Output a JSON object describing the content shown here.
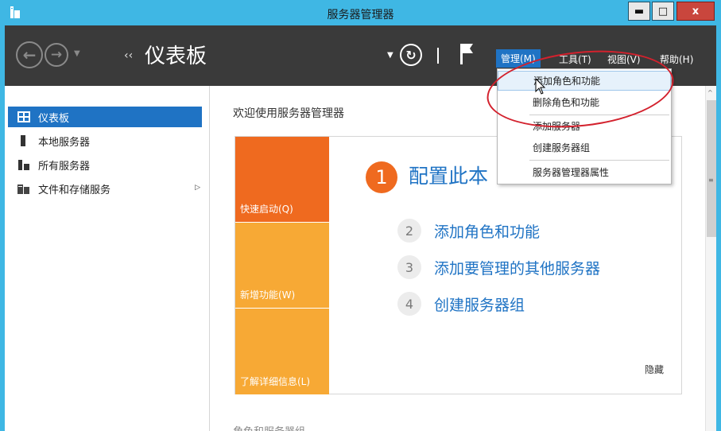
{
  "window": {
    "title": "服务器管理器",
    "minimize_glyph": "▬",
    "maximize_glyph": "□",
    "close_glyph": "x"
  },
  "header": {
    "breadcrumb_arrows": "‹‹",
    "page_title": "仪表板",
    "menus": {
      "manage": "管理(M)",
      "tools": "工具(T)",
      "view": "视图(V)",
      "help": "帮助(H)"
    }
  },
  "sidebar": {
    "items": [
      {
        "label": "仪表板",
        "icon": "dashboard-icon",
        "active": true
      },
      {
        "label": "本地服务器",
        "icon": "server-icon"
      },
      {
        "label": "所有服务器",
        "icon": "servers-icon"
      },
      {
        "label": "文件和存储服务",
        "icon": "storage-icon",
        "has_submenu": true
      }
    ]
  },
  "main": {
    "welcome": "欢迎使用服务器管理器",
    "tiles": {
      "quick_start": "快速启动(Q)",
      "whats_new": "新增功能(W)",
      "learn_more": "了解详细信息(L)"
    },
    "steps": [
      {
        "num": "1",
        "label": "配置此本"
      },
      {
        "num": "2",
        "label": "添加角色和功能"
      },
      {
        "num": "3",
        "label": "添加要管理的其他服务器"
      },
      {
        "num": "4",
        "label": "创建服务器组"
      }
    ],
    "hide": "隐藏",
    "next_section": "角色和服务器组"
  },
  "dropdown": {
    "items": [
      "添加角色和功能",
      "删除角色和功能",
      "添加服务器",
      "创建服务器组",
      "服务器管理器属性"
    ]
  },
  "colors": {
    "title_bar": "#3fb7e4",
    "header_bg": "#3a3a3a",
    "accent_blue": "#1f73c4",
    "orange": "#ef6a1f",
    "amber": "#f7a935",
    "annotation_red": "#d3212d"
  }
}
